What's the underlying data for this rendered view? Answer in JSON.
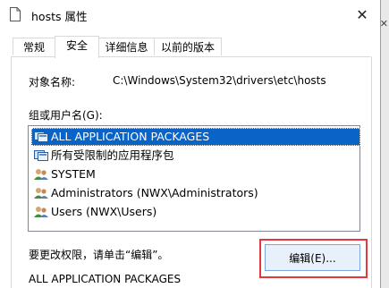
{
  "window": {
    "title": "hosts 属性"
  },
  "tabs": [
    {
      "label": "常规"
    },
    {
      "label": "安全"
    },
    {
      "label": "详细信息"
    },
    {
      "label": "以前的版本"
    }
  ],
  "object": {
    "label": "对象名称:",
    "value": "C:\\Windows\\System32\\drivers\\etc\\hosts"
  },
  "groups": {
    "label": "组或用户名(G):",
    "items": [
      {
        "label": "ALL APPLICATION PACKAGES",
        "icon": "package-group-icon",
        "selected": true
      },
      {
        "label": "所有受限制的应用程序包",
        "icon": "package-group-icon",
        "selected": false
      },
      {
        "label": "SYSTEM",
        "icon": "users-icon",
        "selected": false
      },
      {
        "label": "Administrators (NWX\\Administrators)",
        "icon": "users-icon",
        "selected": false
      },
      {
        "label": "Users (NWX\\Users)",
        "icon": "users-icon",
        "selected": false
      }
    ]
  },
  "hint": "要更改权限，请单击“编辑”。",
  "edit_button": "编辑(E)...",
  "permissions_for": "ALL APPLICATION PACKAGES",
  "colors": {
    "selection": "#0a64c8",
    "highlight": "#e4393c"
  }
}
